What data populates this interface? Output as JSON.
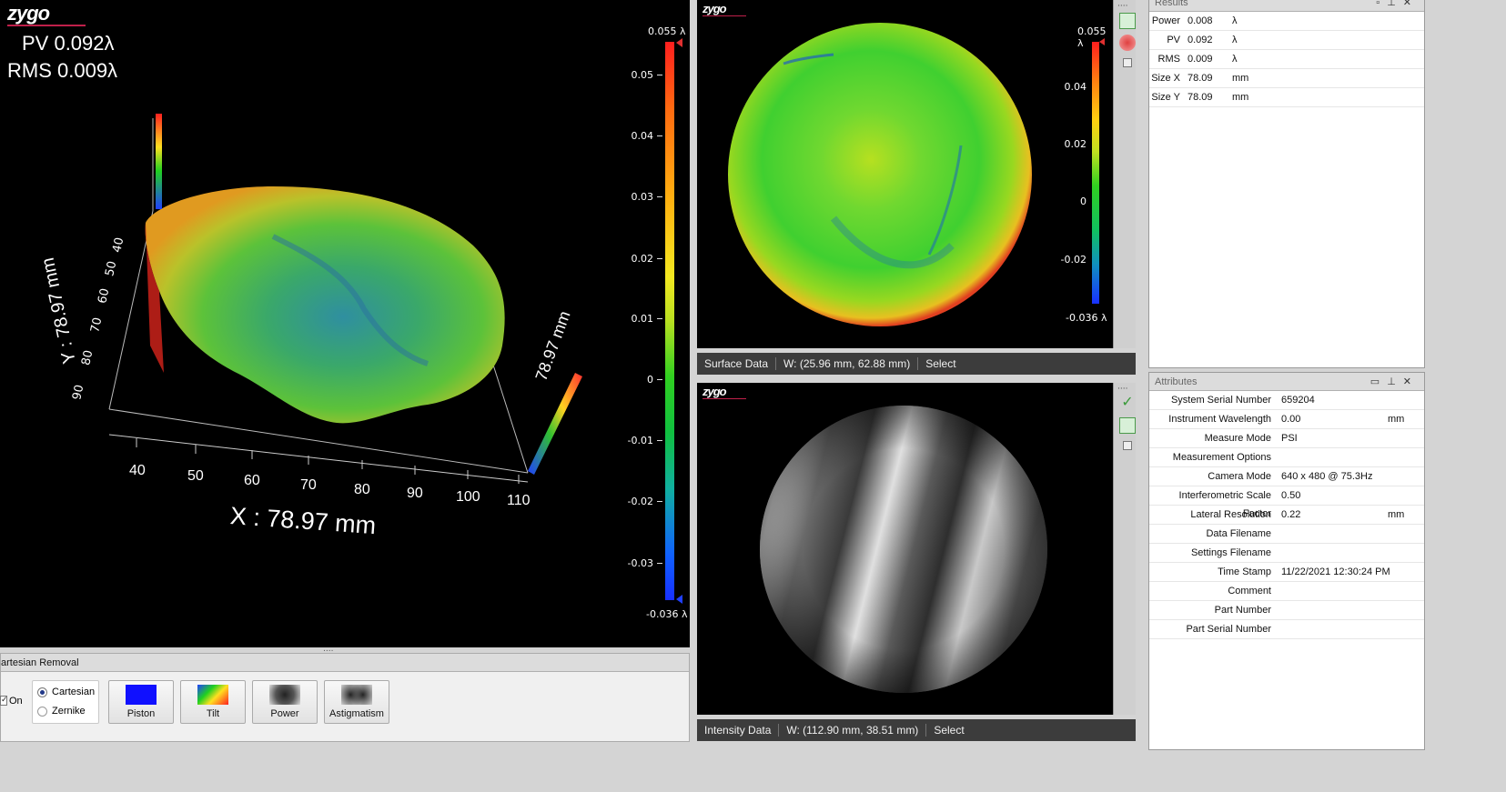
{
  "logo_text": "zygo",
  "left_panel": {
    "pv": "PV 0.092λ",
    "rms": "RMS 0.009λ",
    "x_title": "X : 78.97 mm",
    "y_title": "Y : 78.97 mm",
    "y_title_right": "78.97 mm",
    "x_ticks": [
      "40",
      "50",
      "60",
      "70",
      "80",
      "90",
      "100",
      "110"
    ],
    "y_ticks": [
      "90",
      "80",
      "70",
      "60",
      "50",
      "40"
    ],
    "colorbar": {
      "top": "0.055 λ",
      "bottom": "-0.036 λ",
      "ticks": [
        "0.05",
        "0.04",
        "0.03",
        "0.02",
        "0.01",
        "0",
        "-0.01",
        "-0.02",
        "-0.03"
      ]
    }
  },
  "removal_panel": {
    "title": "artesian Removal",
    "on_label": "On",
    "radio_cartesian": "Cartesian",
    "radio_zernike": "Zernike",
    "buttons": [
      "Piston",
      "Tilt",
      "Power",
      "Astigmatism"
    ]
  },
  "surface_panel": {
    "colorbar": {
      "top": "0.055 λ",
      "bottom": "-0.036 λ",
      "ticks": [
        "0.04",
        "0.02",
        "0",
        "-0.02"
      ]
    },
    "status": [
      "Surface Data",
      "W: (25.96 mm, 62.88 mm)",
      "Select"
    ]
  },
  "intensity_panel": {
    "status": [
      "Intensity Data",
      "W: (112.90 mm, 38.51 mm)",
      "Select"
    ]
  },
  "results": {
    "title": "Results",
    "rows": [
      {
        "k": "Power",
        "v": "0.008",
        "u": "λ"
      },
      {
        "k": "PV",
        "v": "0.092",
        "u": "λ"
      },
      {
        "k": "RMS",
        "v": "0.009",
        "u": "λ"
      },
      {
        "k": "Size X",
        "v": "78.09",
        "u": "mm"
      },
      {
        "k": "Size Y",
        "v": "78.09",
        "u": "mm"
      }
    ]
  },
  "attributes": {
    "title": "Attributes",
    "rows": [
      {
        "k": "System Serial Number",
        "v": "659204",
        "u": ""
      },
      {
        "k": "Instrument Wavelength",
        "v": "0.00",
        "u": "mm"
      },
      {
        "k": "Measure Mode",
        "v": "PSI",
        "u": ""
      },
      {
        "k": "Measurement Options",
        "v": "",
        "u": ""
      },
      {
        "k": "Camera Mode",
        "v": "640 x 480 @ 75.3Hz",
        "u": ""
      },
      {
        "k": "Interferometric Scale Factor",
        "v": "0.50",
        "u": ""
      },
      {
        "k": "Lateral Resolution",
        "v": "0.22",
        "u": "mm"
      },
      {
        "k": "Data Filename",
        "v": "",
        "u": ""
      },
      {
        "k": "Settings Filename",
        "v": "",
        "u": ""
      },
      {
        "k": "Time Stamp",
        "v": "11/22/2021 12:30:24 PM",
        "u": ""
      },
      {
        "k": "Comment",
        "v": "",
        "u": ""
      },
      {
        "k": "Part Number",
        "v": "",
        "u": ""
      },
      {
        "k": "Part Serial Number",
        "v": "",
        "u": ""
      }
    ]
  }
}
